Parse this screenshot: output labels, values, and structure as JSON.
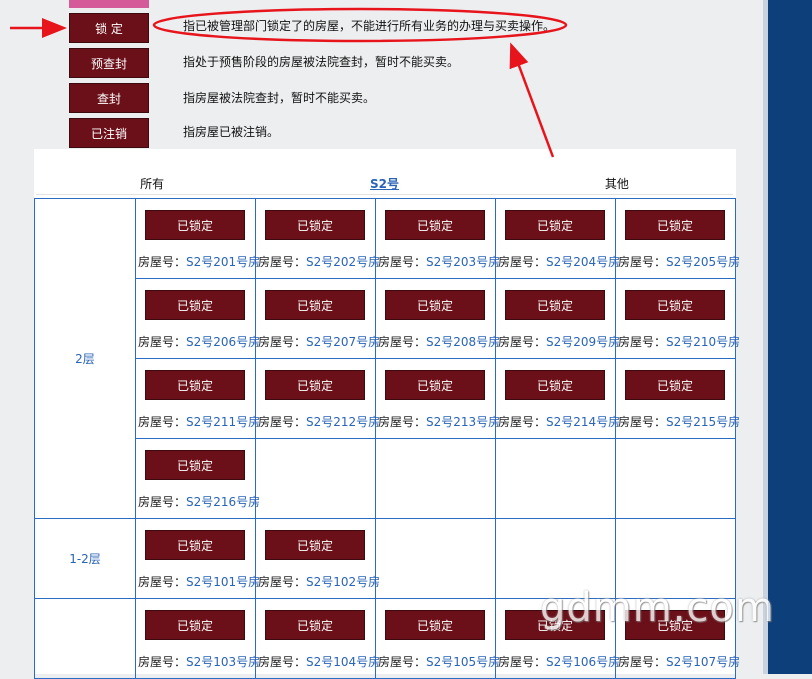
{
  "legend": [
    {
      "label": "锁 定",
      "desc": "指已被管理部门锁定了的房屋，不能进行所有业务的办理与买卖操作。"
    },
    {
      "label": "预查封",
      "desc": "指处于预售阶段的房屋被法院查封，暂时不能买卖。"
    },
    {
      "label": "查封",
      "desc": "指房屋被法院查封，暂时不能买卖。"
    },
    {
      "label": "已注销",
      "desc": "指房屋已被注销。"
    }
  ],
  "tabs": {
    "all": "所有",
    "building": "S2号",
    "other": "其他"
  },
  "room_prefix": "房屋号：",
  "status_label": "已锁定",
  "floors": [
    {
      "name": "2层",
      "rows": [
        [
          "S2号201号房",
          "S2号202号房",
          "S2号203号房",
          "S2号204号房",
          "S2号205号房"
        ],
        [
          "S2号206号房",
          "S2号207号房",
          "S2号208号房",
          "S2号209号房",
          "S2号210号房"
        ],
        [
          "S2号211号房",
          "S2号212号房",
          "S2号213号房",
          "S2号214号房",
          "S2号215号房"
        ],
        [
          "S2号216号房"
        ]
      ]
    },
    {
      "name": "1-2层",
      "rows": [
        [
          "S2号101号房",
          "S2号102号房"
        ]
      ]
    },
    {
      "name": "",
      "rows": [
        [
          "S2号103号房",
          "S2号104号房",
          "S2号105号房",
          "S2号106号房",
          "S2号107号房"
        ]
      ]
    }
  ],
  "watermark": "gdmm.com",
  "colors": {
    "status": "#6b0f18",
    "annotation": "#e8141c",
    "link": "#2a64b6",
    "sidebar": "#0d3f7a"
  }
}
